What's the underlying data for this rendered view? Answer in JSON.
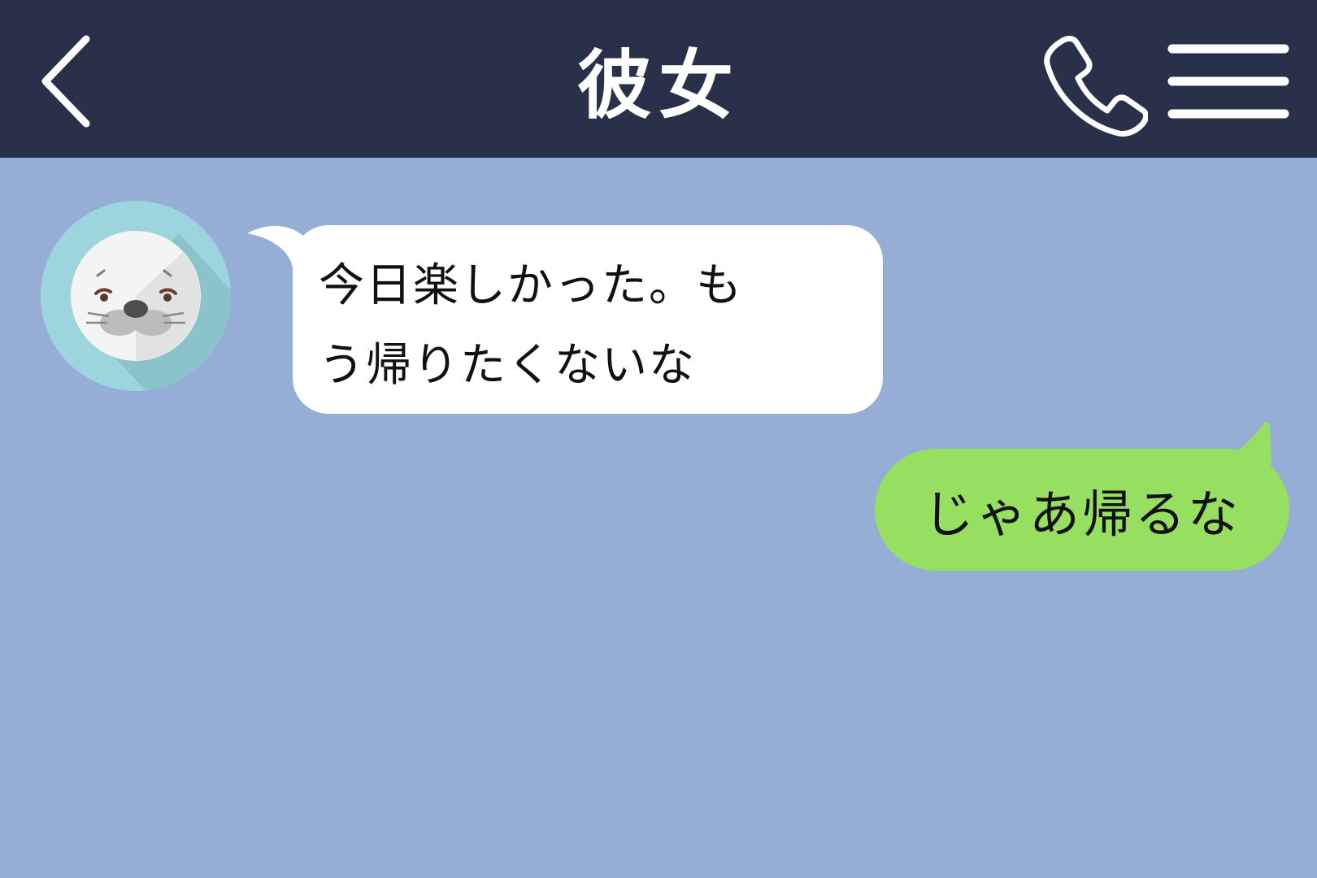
{
  "colors": {
    "header_bg": "#283149",
    "chat_bg": "#96aed6",
    "incoming_bubble": "#ffffff",
    "outgoing_bubble": "#97df61",
    "avatar_ring": "#9cd5de"
  },
  "header": {
    "title": "彼女",
    "back_icon": "chevron-left-icon",
    "call_icon": "phone-icon",
    "menu_icon": "hamburger-menu-icon"
  },
  "messages": [
    {
      "direction": "incoming",
      "avatar": "seal-avatar",
      "text": "今日楽しかった。も\nう帰りたくないな"
    },
    {
      "direction": "outgoing",
      "text": "じゃあ帰るな"
    }
  ]
}
